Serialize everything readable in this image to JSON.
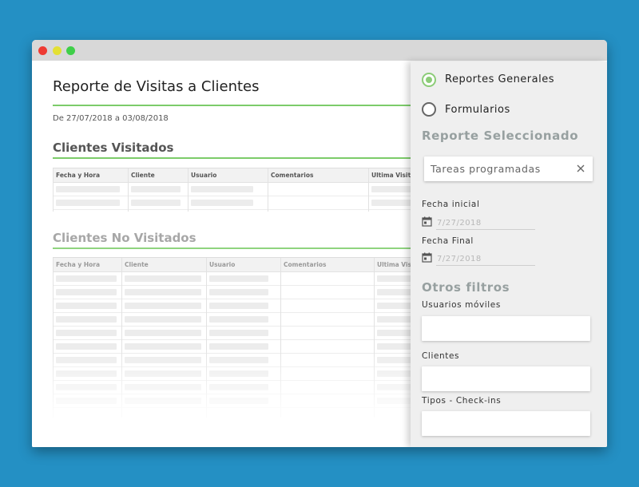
{
  "report": {
    "title": "Reporte de Visitas a Clientes",
    "date_range": "De 27/07/2018 a 03/08/2018",
    "visited": {
      "heading": "Clientes Visitados",
      "columns": [
        "Fecha y Hora",
        "Cliente",
        "Usuario",
        "Comentarios",
        "Ultima Visita"
      ]
    },
    "not_visited": {
      "heading": "Clientes No Visitados",
      "columns": [
        "Fecha y Hora",
        "Cliente",
        "Usuario",
        "Comentarios",
        "Ultima Visita"
      ]
    }
  },
  "panel": {
    "radio_options": [
      {
        "label": "Reportes Generales",
        "selected": true
      },
      {
        "label": "Formularios",
        "selected": false
      }
    ],
    "selected_report_heading": "Reporte Seleccionado",
    "selected_report_value": "Tareas programadas",
    "start_date_label": "Fecha inicial",
    "start_date_value": "7/27/2018",
    "end_date_label": "Fecha Final",
    "end_date_value": "7/27/2018",
    "other_filters_heading": "Otros filtros",
    "filters": [
      {
        "label": "Usuarios móviles"
      },
      {
        "label": "Clientes"
      },
      {
        "label": "Tipos - Check-ins"
      }
    ]
  },
  "colors": {
    "background": "#2490c4",
    "accent_green": "#7ccc6a",
    "panel_bg": "#efefef"
  }
}
